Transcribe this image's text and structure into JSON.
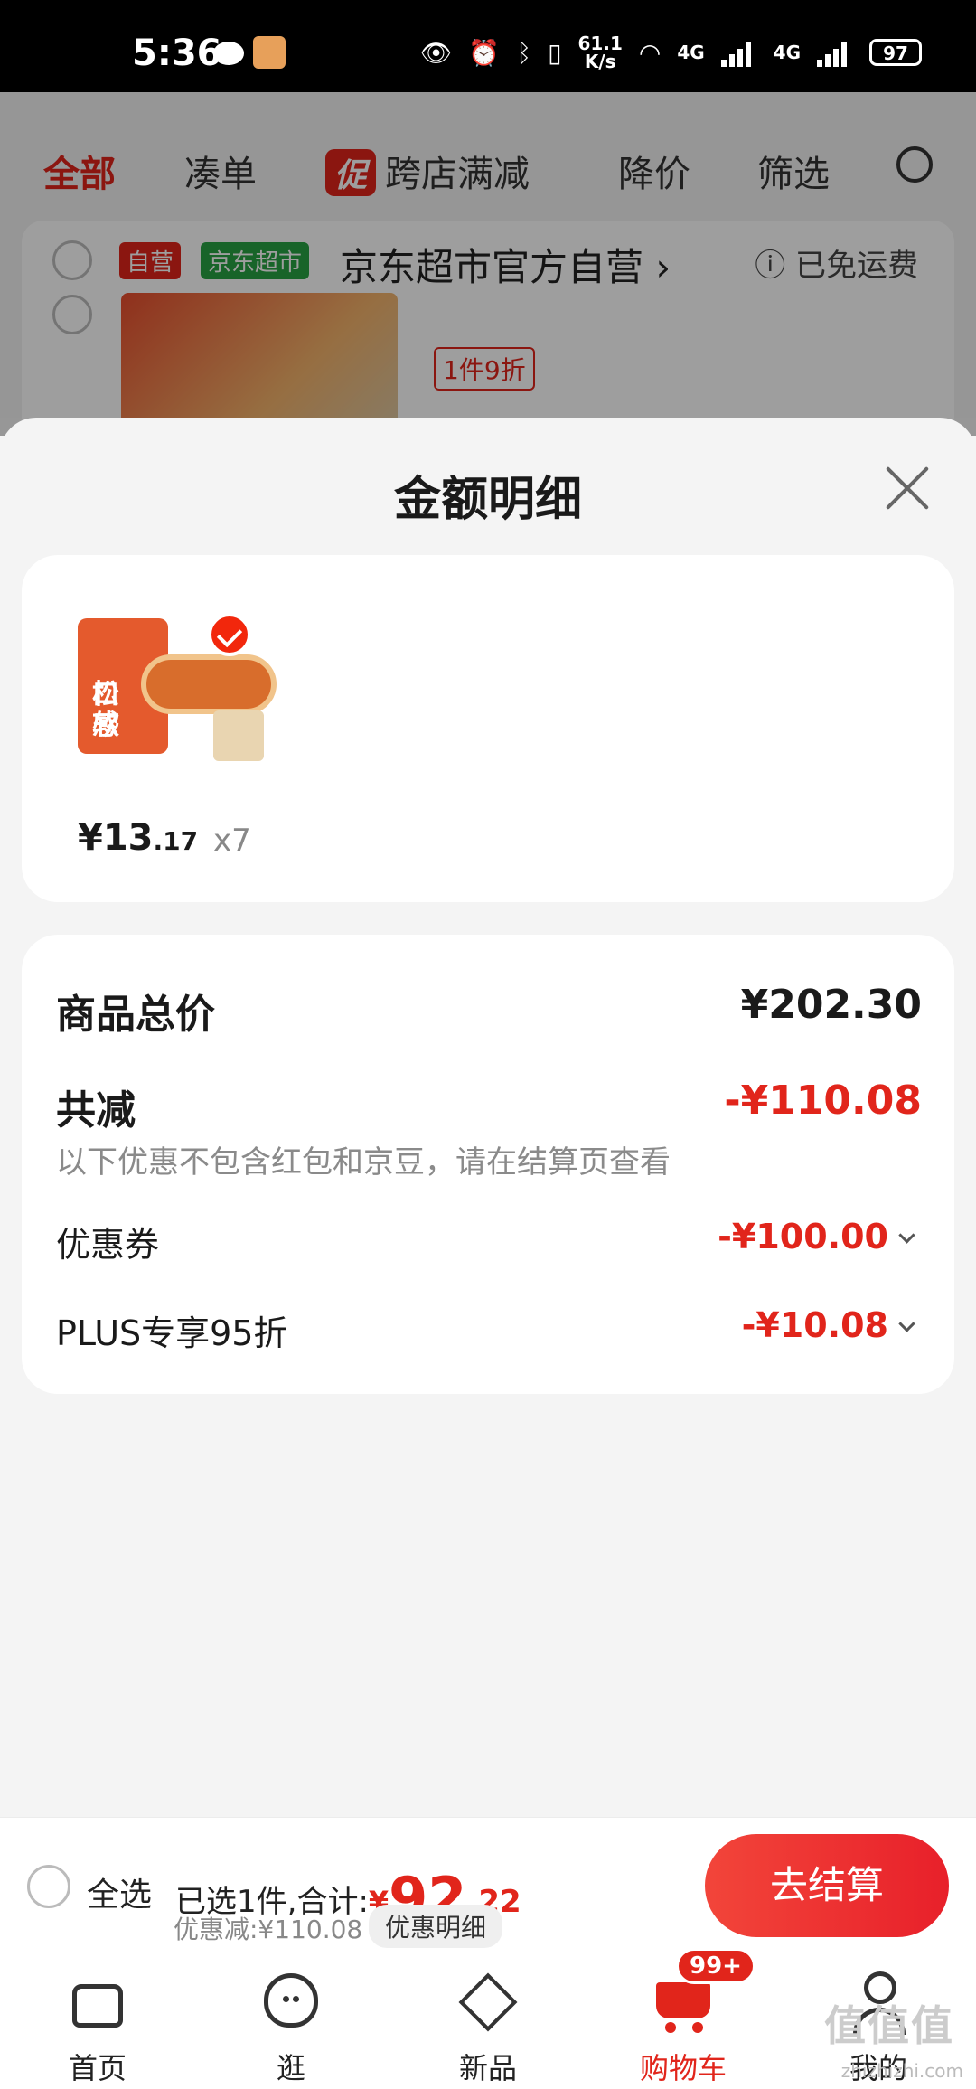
{
  "status_bar": {
    "time": "5:36",
    "net_speed": "61.1\nK/s",
    "net_speed_top": "61.1",
    "net_speed_bottom": "K/s",
    "network_1": "4G",
    "network_2": "4G",
    "battery": "97"
  },
  "background": {
    "tabs": [
      {
        "label": "全部"
      },
      {
        "label": "凑单"
      },
      {
        "label": "跨店满减",
        "badge": "促"
      },
      {
        "label": "降价"
      },
      {
        "label": "筛选"
      }
    ],
    "tag_self": "自营",
    "tag_market": "京东超市",
    "shop_name": "京东超市官方自营",
    "shop_chevron": "›",
    "shipping": "已免运费",
    "discount": "1件9折"
  },
  "sheet": {
    "title": "金额明细",
    "product": {
      "price_int": "¥13",
      "price_dec": ".17",
      "qty": "x7",
      "thumb_text": "口感\n松软",
      "thumb_text_1": "口感",
      "thumb_text_2": "松软"
    },
    "detail": {
      "total_label": "商品总价",
      "total_value": "¥202.30",
      "reduce_label": "共减",
      "reduce_value": "-¥110.08",
      "note": "以下优惠不包含红包和京豆，请在结算页查看",
      "coupon_label": "优惠券",
      "coupon_value": "-¥100.00",
      "plus_label": "PLUS专享95折",
      "plus_value": "-¥10.08"
    }
  },
  "checkout": {
    "select_all": "全选",
    "selected_text": "已选1件,合计:",
    "total_yen": "¥",
    "total_int": "92",
    "total_dec": ".22",
    "savings": "优惠减:¥110.08",
    "detail_button": "优惠明细",
    "submit": "去结算"
  },
  "tabbar": {
    "items": [
      {
        "label": "首页",
        "icon": "home-icon"
      },
      {
        "label": "逛",
        "icon": "face-icon"
      },
      {
        "label": "新品",
        "icon": "box-icon"
      },
      {
        "label": "购物车",
        "icon": "cart-icon",
        "badge": "99+"
      },
      {
        "label": "我的",
        "icon": "user-icon"
      }
    ]
  },
  "watermark": {
    "logo": "值值值",
    "text": "zhizhizhi.com"
  },
  "colors": {
    "accent": "#e1251b",
    "background": "#f4f4f4"
  }
}
